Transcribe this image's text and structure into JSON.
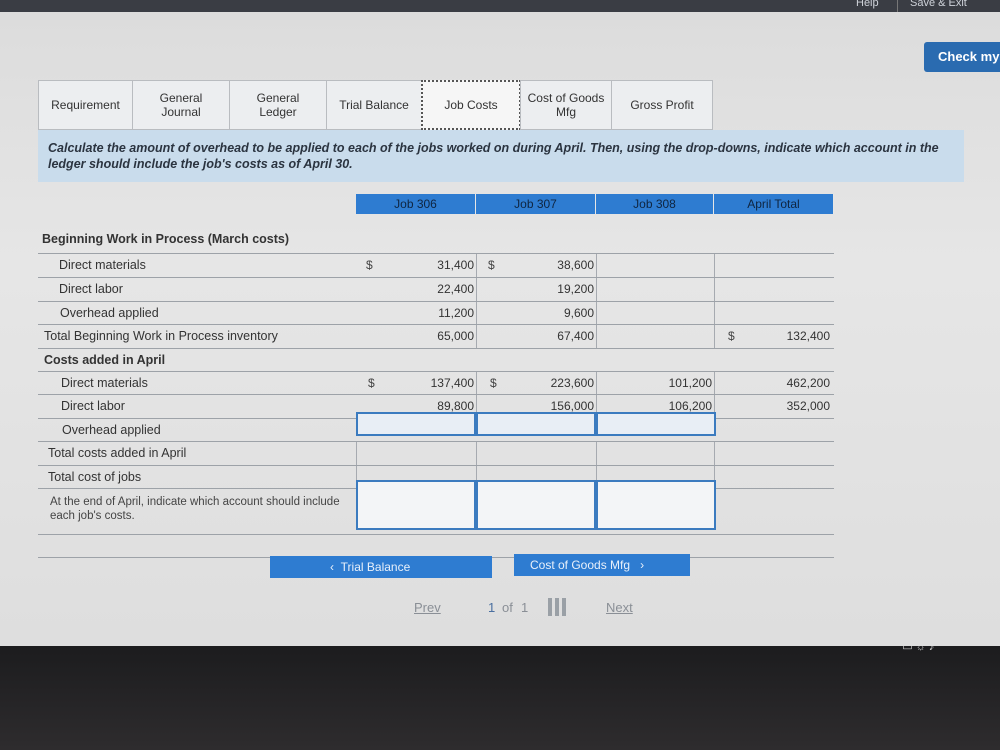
{
  "topbar": {
    "help": "Help",
    "save_exit": "Save & Exit"
  },
  "check_button": "Check my",
  "tabs": [
    {
      "label": "Requirement"
    },
    {
      "label": "General Journal"
    },
    {
      "label": "General Ledger"
    },
    {
      "label": "Trial Balance"
    },
    {
      "label": "Job Costs"
    },
    {
      "label": "Cost of Goods Mfg"
    },
    {
      "label": "Gross Profit"
    }
  ],
  "instruction": "Calculate the amount of overhead to be applied to each of the jobs worked on during April. Then, using the drop-downs, indicate which account in the ledger should include the job's costs as of April 30.",
  "table": {
    "headers": [
      "Job 306",
      "Job 307",
      "Job 308",
      "April Total"
    ],
    "rows": {
      "beg_wip": "Beginning Work in Process (March costs)",
      "dm": "Direct materials",
      "dl": "Direct labor",
      "oh": "Overhead applied",
      "total_beg": "Total Beginning Work in Process inventory",
      "costs_added": "Costs added in April",
      "dm2": "Direct materials",
      "dl2": "Direct labor",
      "oh2": "Overhead applied",
      "total_added": "Total costs added in April",
      "total_cost": "Total cost of jobs",
      "end_note": "At the end of April, indicate which account should include each job's costs."
    },
    "dollar": "$",
    "values": {
      "j306_dm": "31,400",
      "j306_dl": "22,400",
      "j306_oh": "11,200",
      "j306_total": "65,000",
      "j307_dm": "38,600",
      "j307_dl": "19,200",
      "j307_oh": "9,600",
      "j307_total": "67,400",
      "april_total_beg": "132,400",
      "j306_dm2": "137,400",
      "j306_dl2": "89,800",
      "j307_dm2": "223,600",
      "j307_dl2": "156,000",
      "j308_dm2": "101,200",
      "j308_dl2": "106,200",
      "april_dm2": "462,200",
      "april_dl2": "352,000"
    }
  },
  "nav": {
    "prev_tab": "Trial Balance",
    "next_tab": "Cost of Goods Mfg",
    "prev": "Prev",
    "page": "1",
    "of": "of",
    "total": "1",
    "next": "Next"
  }
}
